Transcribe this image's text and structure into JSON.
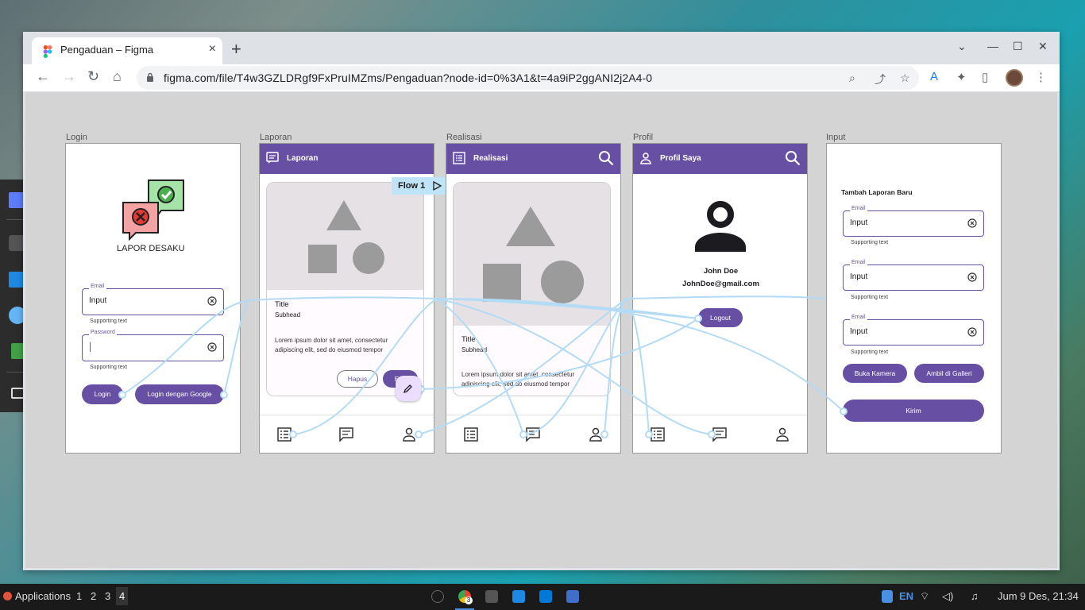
{
  "browser": {
    "tab_title": "Pengaduan – Figma",
    "url": "figma.com/file/T4w3GZLDRgf9FxPruIMZms/Pengaduan?node-id=0%3A1&t=4a9iP2ggANI2j2A4-0"
  },
  "canvas": {
    "flow_tag": "Flow 1",
    "frames": {
      "login": {
        "label": "Login",
        "brand": "LAPOR DESAKU",
        "email_label": "Email",
        "email_value": "Input",
        "email_support": "Supporting text",
        "password_label": "Password",
        "password_support": "Supporting text",
        "login_btn": "Login",
        "google_btn": "Login dengan Google"
      },
      "laporan": {
        "label": "Laporan",
        "appbar_title": "Laporan",
        "card_title": "Title",
        "card_subhead": "Subhead",
        "card_body": "Lorem ipsum dolor sit amet, consectetur adipiscing elit, sed do eiusmod tempor",
        "hapus_btn": "Hapus",
        "edit_btn": "Edit"
      },
      "realisasi": {
        "label": "Realisasi",
        "appbar_title": "Realisasi",
        "card_title": "Title",
        "card_subhead": "Subhead",
        "card_body": "Lorem ipsum dolor sit amet, consectetur adipiscing elit, sed do eiusmod tempor"
      },
      "profil": {
        "label": "Profil",
        "appbar_title": "Profil Saya",
        "name": "John Doe",
        "email": "JohnDoe@gmail.com",
        "logout_btn": "Logout"
      },
      "input": {
        "label": "Input",
        "heading": "Tambah Laporan Baru",
        "fields": [
          {
            "label": "Email",
            "value": "Input",
            "support": "Supporting text"
          },
          {
            "label": "Email",
            "value": "Input",
            "support": "Supporting text"
          },
          {
            "label": "Email",
            "value": "Input",
            "support": "Supporting text"
          }
        ],
        "camera_btn": "Buka Kamera",
        "gallery_btn": "Ambil di Galleri",
        "submit_btn": "Kirim"
      }
    }
  },
  "taskbar": {
    "applications": "Applications",
    "workspaces": [
      "1",
      "2",
      "3",
      "4"
    ],
    "lang": "EN",
    "clock": "Jum  9 Des, 21:34",
    "chrome_badge": "3"
  },
  "colors": {
    "primary": "#6750a4",
    "flow_line": "#b3dbf5"
  }
}
